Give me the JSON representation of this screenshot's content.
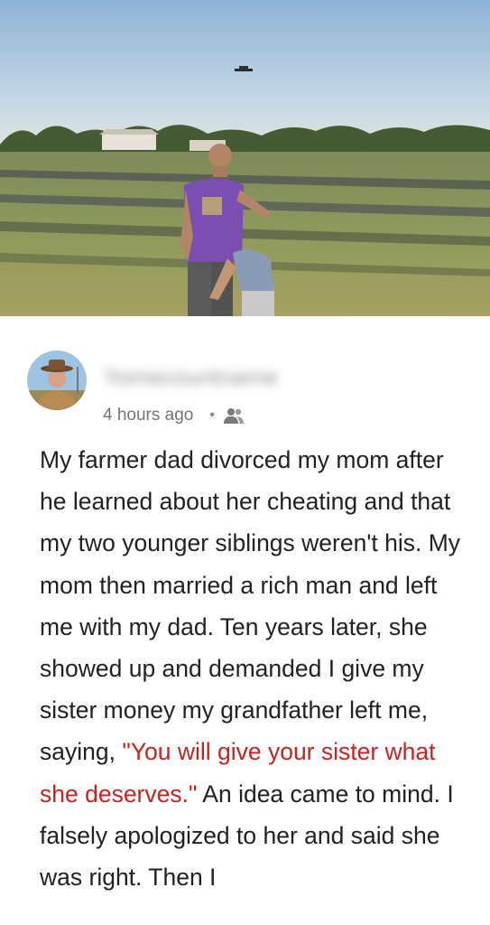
{
  "hero": {
    "image_name": "farm-field-drone-photo",
    "description_icon": "photo"
  },
  "author": {
    "name": "Yomecountname",
    "avatar_icon": "farmer-avatar-icon",
    "timestamp": "4 hours ago",
    "separator": "•",
    "visibility_icon": "group-icon"
  },
  "story": {
    "part1": "My farmer dad divorced my mom after he learned about her cheating and that my two younger siblings weren't his. My mom then married a rich man and left me with my dad. Ten years later, she showed up and demanded I give my sister money my grandfather left me, saying, ",
    "quote": "\"You will give your sister what she deserves.\"",
    "part2": " An idea came to mind. I falsely apologized to her and said she was right. Then I"
  },
  "colors": {
    "quote": "#d01f1f",
    "text": "#222222",
    "meta": "#757575"
  }
}
